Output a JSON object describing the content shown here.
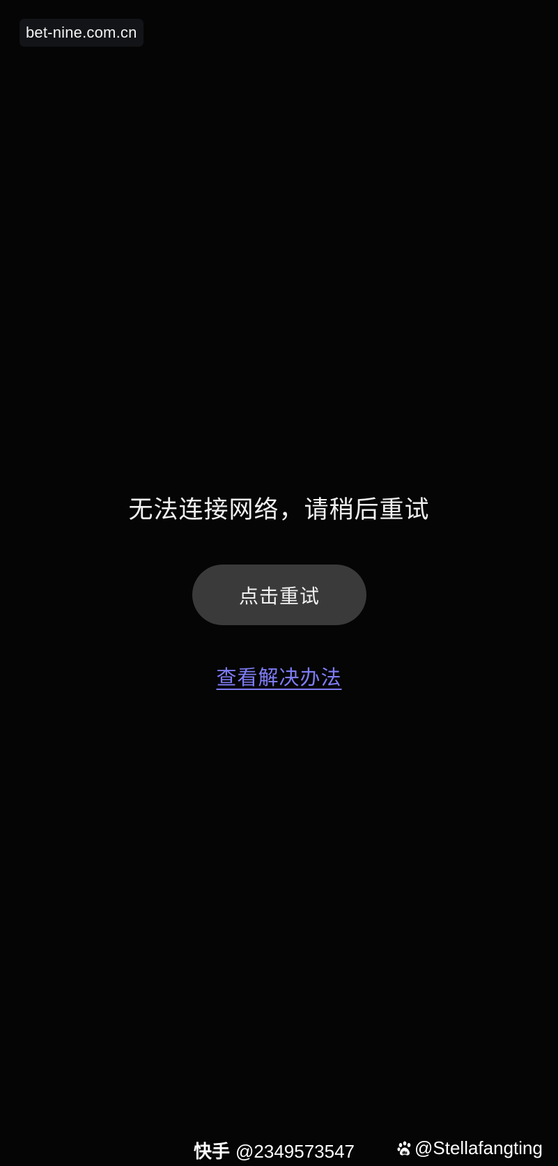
{
  "overlay": {
    "source_label": "bet-nine.com.cn"
  },
  "error": {
    "message": "无法连接网络，请稍后重试",
    "retry_button_label": "点击重试",
    "solution_link_label": "查看解决办法"
  },
  "watermarks": {
    "kuaishou_brand": "快手",
    "kuaishou_id": "@2349573547",
    "baidu_handle": "@Stellafangting"
  },
  "colors": {
    "background": "#050505",
    "button_background": "#3a3a3a",
    "link": "#7e7cf4",
    "text": "#f0f0f0"
  }
}
